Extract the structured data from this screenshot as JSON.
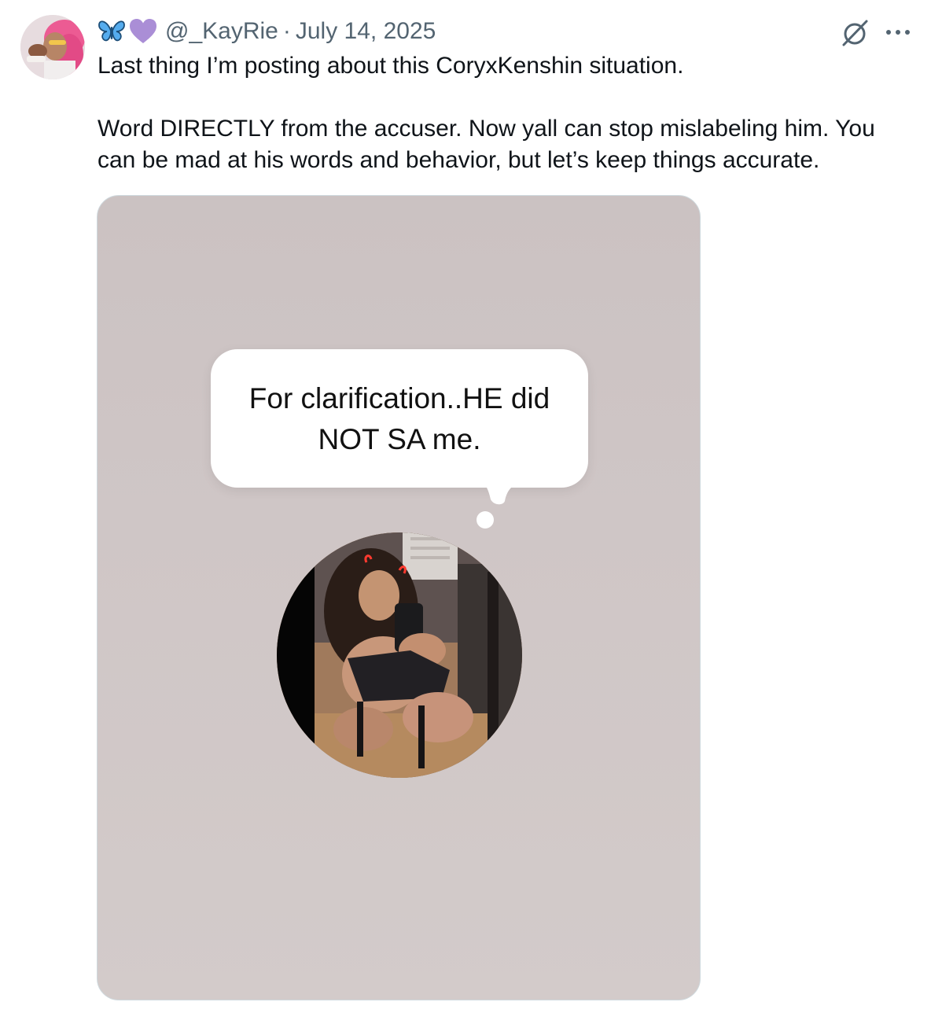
{
  "tweet": {
    "display_emojis": [
      "butterfly-icon",
      "purple-heart-icon"
    ],
    "handle": "@_KayRie",
    "separator": "·",
    "date": "July 14, 2025",
    "text_lines": [
      "Last thing I’m posting about this CoryxKenshin situation.",
      "",
      "Word DIRECTLY from the accuser. Now yall can stop mislabeling him. You",
      "can be mad at his words and behavior, but let’s keep things accurate."
    ]
  },
  "media": {
    "bubble_line_1": "For clarification..HE did",
    "bubble_line_2": "NOT SA me."
  },
  "colors": {
    "text_primary": "#0f1419",
    "text_secondary": "#536471",
    "butterfly": "#3b88c3",
    "heart": "#aa8ed6",
    "media_bg": "#cbc2c2"
  }
}
